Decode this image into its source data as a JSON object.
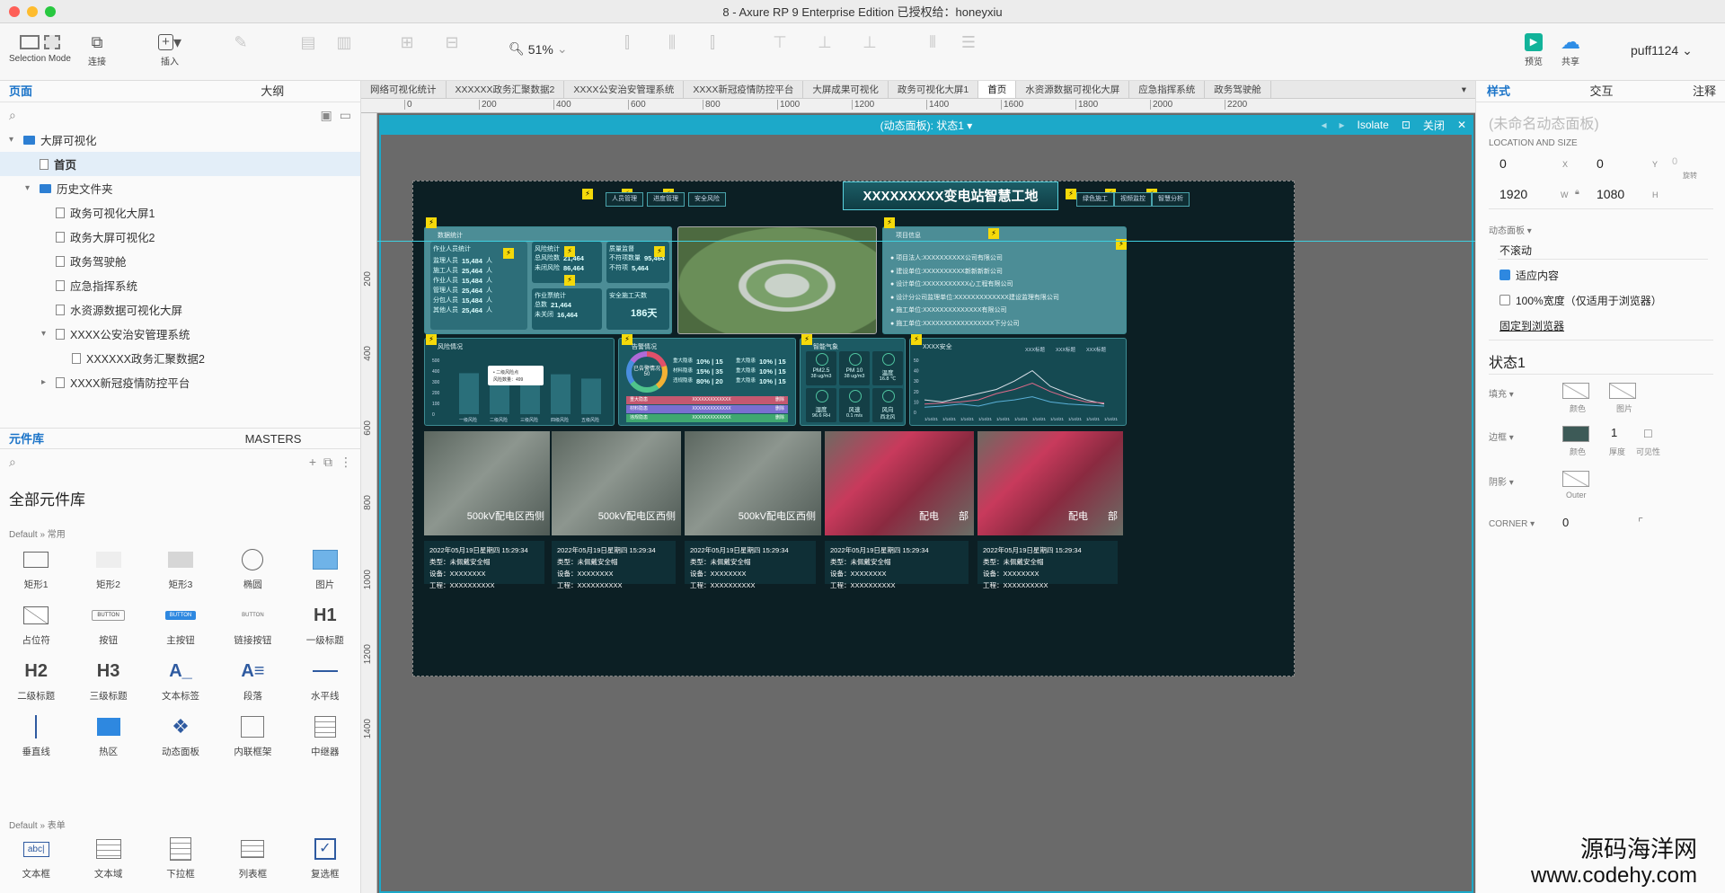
{
  "window": {
    "title": "8 - Axure RP 9 Enterprise Edition  已授权给：honeyxiu"
  },
  "toolbar": {
    "selection_mode": "Selection Mode",
    "connect": "连接",
    "insert": "插入",
    "zoom": "51%",
    "preview": "预览",
    "share": "共享",
    "user": "puff1124"
  },
  "left": {
    "tab_pages": "页面",
    "tab_outline": "大纲",
    "tree": [
      {
        "label": "大屏可视化",
        "type": "folder",
        "indent": 0,
        "expand": "▾"
      },
      {
        "label": "首页",
        "type": "page",
        "indent": 1,
        "selected": true
      },
      {
        "label": "历史文件夹",
        "type": "folder",
        "indent": 1,
        "expand": "▾"
      },
      {
        "label": "政务可视化大屏1",
        "type": "page",
        "indent": 2
      },
      {
        "label": "政务大屏可视化2",
        "type": "page",
        "indent": 2
      },
      {
        "label": "政务驾驶舱",
        "type": "page",
        "indent": 2
      },
      {
        "label": "应急指挥系统",
        "type": "page",
        "indent": 2
      },
      {
        "label": "水资源数据可视化大屏",
        "type": "page",
        "indent": 2
      },
      {
        "label": "XXXX公安治安管理系统",
        "type": "page",
        "indent": 2,
        "expand": "▾"
      },
      {
        "label": "XXXXXX政务汇聚数据2",
        "type": "page",
        "indent": 3
      },
      {
        "label": "XXXX新冠疫情防控平台",
        "type": "page",
        "indent": 2,
        "expand": "▸"
      }
    ],
    "tab_library": "元件库",
    "tab_masters": "MASTERS",
    "library_title": "全部元件库",
    "group_common": "Default » 常用",
    "group_form": "Default » 表单",
    "widgets": [
      {
        "label": "矩形1",
        "icon": "rect-outline-icon"
      },
      {
        "label": "矩形2",
        "icon": "rect-light-icon"
      },
      {
        "label": "矩形3",
        "icon": "rect-gray-icon"
      },
      {
        "label": "椭圆",
        "icon": "ellipse-icon"
      },
      {
        "label": "图片",
        "icon": "image-icon"
      },
      {
        "label": "占位符",
        "icon": "placeholder-icon"
      },
      {
        "label": "按钮",
        "icon": "button-icon"
      },
      {
        "label": "主按钮",
        "icon": "primary-button-icon"
      },
      {
        "label": "链接按钮",
        "icon": "link-button-icon"
      },
      {
        "label": "一级标题",
        "icon": "h1-icon"
      },
      {
        "label": "二级标题",
        "icon": "h2-icon"
      },
      {
        "label": "三级标题",
        "icon": "h3-icon"
      },
      {
        "label": "文本标签",
        "icon": "text-label-icon"
      },
      {
        "label": "段落",
        "icon": "paragraph-icon"
      },
      {
        "label": "水平线",
        "icon": "hline-icon"
      },
      {
        "label": "垂直线",
        "icon": "vline-icon"
      },
      {
        "label": "热区",
        "icon": "hotspot-icon"
      },
      {
        "label": "动态面板",
        "icon": "dynamic-panel-icon"
      },
      {
        "label": "内联框架",
        "icon": "inline-frame-icon"
      },
      {
        "label": "中继器",
        "icon": "repeater-icon"
      }
    ],
    "form_widgets": [
      {
        "label": "文本框",
        "icon": "textbox-icon"
      },
      {
        "label": "文本域",
        "icon": "textarea-icon"
      },
      {
        "label": "下拉框",
        "icon": "dropdown-icon"
      },
      {
        "label": "列表框",
        "icon": "listbox-icon"
      },
      {
        "label": "复选框",
        "icon": "checkbox-icon"
      }
    ]
  },
  "doc_tabs": [
    "网络可视化统计",
    "XXXXXX政务汇聚数据2",
    "XXXX公安治安管理系统",
    "XXXX新冠疫情防控平台",
    "大屏成果可视化",
    "政务可视化大屏1",
    "首页",
    "水资源数据可视化大屏",
    "应急指挥系统",
    "政务驾驶舱"
  ],
  "ruler_h": [
    "0",
    "200",
    "400",
    "600",
    "800",
    "1000",
    "1200",
    "1400",
    "1600",
    "1800",
    "2000",
    "2200"
  ],
  "ruler_v": [
    "200",
    "400",
    "600",
    "800",
    "1000",
    "1200",
    "1400"
  ],
  "dynpanel": {
    "title": "(动态面板):  状态1 ▾",
    "isolate": "Isolate",
    "close": "关闭"
  },
  "dashboard": {
    "title": "XXXXXXXXX变电站智慧工地",
    "nav_left": [
      "人员管理",
      "进度管理",
      "安全风险"
    ],
    "nav_right": [
      "绿色施工",
      "视频监控",
      "智慧分析"
    ],
    "p_data": "数据统计",
    "workers_title": "作业人员统计",
    "workers": [
      [
        "监理人员",
        "15,484",
        "人"
      ],
      [
        "施工人员",
        "25,464",
        "人"
      ],
      [
        "作业人员",
        "15,484",
        "人"
      ],
      [
        "管理人员",
        "25,464",
        "人"
      ],
      [
        "分包人员",
        "15,484",
        "人"
      ],
      [
        "其他人员",
        "25,464",
        "人"
      ]
    ],
    "risk_title": "风险统计",
    "risk": [
      [
        "总风险数",
        "21,464"
      ],
      [
        "未闭风险",
        "86,464"
      ]
    ],
    "quality_title": "质量监督",
    "quality": [
      [
        "不符项数量",
        "95,464"
      ],
      [
        "不符项",
        "5,464"
      ]
    ],
    "job_title": "作业票统计",
    "job": [
      [
        "总数",
        "21,464"
      ],
      [
        "未关闭",
        "16,464"
      ]
    ],
    "safe_title": "安全施工天数",
    "safe_days": "186天",
    "p_info": "项目信息",
    "info": [
      "项目法人:XXXXXXXXXX公司有限公司",
      "建设单位:XXXXXXXXXX新新新新公司",
      "设计单位:XXXXXXXXXXX心工程有限公司",
      "设计分公司监理单位:XXXXXXXXXXXXX建设监理有限公司",
      "施工单位:XXXXXXXXXXXXXX有限公司",
      "施工单位:XXXXXXXXXXXXXXXXX下分公司"
    ],
    "p_risk": "风险情况",
    "risk_tip": [
      "• 二级风险点",
      "风险数量：499"
    ],
    "risk_y": [
      "500",
      "400",
      "300",
      "200",
      "100",
      "0"
    ],
    "risk_x": [
      "一级风险",
      "二级风险",
      "三级风险",
      "四级风险",
      "五级风险"
    ],
    "p_alarm": "告警情况",
    "alarm_center": [
      "已告警情况",
      "50"
    ],
    "alarm_rows": [
      [
        "重大隐患",
        "10% | 15"
      ],
      [
        "材料隐患",
        "15% | 35"
      ],
      [
        "违规隐患",
        "80% | 20"
      ]
    ],
    "alarm_rows2": [
      [
        "重大隐患",
        "10% | 15"
      ],
      [
        "重大隐患",
        "10% | 15"
      ],
      [
        "重大隐患",
        "10% | 15"
      ]
    ],
    "alarm_list": [
      [
        "重大隐患",
        "XXXXXXXXXXXXX",
        "删除"
      ],
      [
        "材料隐患",
        "XXXXXXXXXXXXX",
        "删除"
      ],
      [
        "违规隐患",
        "XXXXXXXXXXXXX",
        "删除"
      ]
    ],
    "p_env": "智能气象",
    "env": [
      [
        "PM2.5",
        "38 ug/m3"
      ],
      [
        "PM 10",
        "38 ug/m3"
      ],
      [
        "温度",
        "16.8 ℃"
      ],
      [
        "湿度",
        "96.6 RH"
      ],
      [
        "风速",
        "0.1 m/s"
      ],
      [
        "风向",
        "西北风"
      ]
    ],
    "p_trend": "XXXX安全",
    "trend_legend": [
      "XXX标题",
      "XXX标题",
      "XXX标题"
    ],
    "trend_y": [
      "50",
      "40",
      "30",
      "20",
      "10",
      "0"
    ],
    "trend_x": [
      "1/14/21",
      "1/14/21",
      "1/14/21",
      "1/14/21",
      "1/14/21",
      "1/14/21",
      "1/14/21",
      "1/14/21",
      "1/14/21",
      "1/14/21",
      "1/14/21"
    ],
    "cam_overlay": [
      "500kV配电区西侧",
      "500kV配电区西侧",
      "500kV配电区西侧",
      "配电　　部",
      "配电　　部"
    ],
    "cams": [
      [
        "2022年05月19日星期四 15:29:34",
        "类型：未佩戴安全帽",
        "设备：XXXXXXXX",
        "工程：XXXXXXXXXX"
      ],
      [
        "2022年05月19日星期四 15:29:34",
        "类型：未佩戴安全帽",
        "设备：XXXXXXXX",
        "工程：XXXXXXXXXX"
      ],
      [
        "2022年05月19日星期四 15:29:34",
        "类型：未佩戴安全帽",
        "设备：XXXXXXXX",
        "工程：XXXXXXXXXX"
      ],
      [
        "2022年05月19日星期四 15:29:34",
        "类型：未佩戴安全帽",
        "设备：XXXXXXXX",
        "工程：XXXXXXXXXX"
      ],
      [
        "2022年05月19日星期四 15:29:34",
        "类型：未佩戴安全帽",
        "设备：XXXXXXXX",
        "工程：XXXXXXXXXX"
      ]
    ]
  },
  "right": {
    "tab_style": "样式",
    "tab_interact": "交互",
    "tab_notes": "注释",
    "name_placeholder": "(未命名动态面板)",
    "loc_size": "LOCATION AND SIZE",
    "x": "0",
    "x_label": "X",
    "y": "0",
    "y_label": "Y",
    "rot": "0",
    "rot_label": "旋转",
    "w": "1920",
    "w_label": "W",
    "h": "1080",
    "h_label": "H",
    "dyn_label": "动态面板 ▾",
    "scroll": "不滚动",
    "fit": "适应内容",
    "fullwidth": "100%宽度（仅适用于浏览器）",
    "pin": "固定到浏览器",
    "state": "状态1",
    "fill": "填充 ▾",
    "fill_color": "颜色",
    "fill_image": "图片",
    "border": "边框 ▾",
    "border_color": "颜色",
    "border_width": "1",
    "border_thick": "厚度",
    "border_vis": "可见性",
    "shadow": "阴影 ▾",
    "shadow_outer": "Outer",
    "corner": "CORNER ▾",
    "corner_val": "0"
  },
  "watermark": [
    "源码海洋网",
    "www.codehy.com"
  ]
}
